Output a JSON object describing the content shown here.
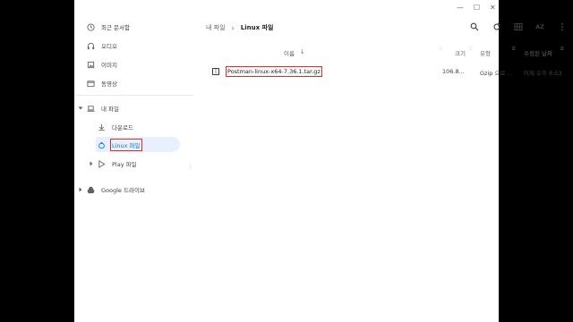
{
  "sidebar": {
    "recent": "최근 문서함",
    "audio": "오디오",
    "images": "이미지",
    "videos": "동영상",
    "my_files": "내 파일",
    "downloads": "다운로드",
    "linux_files": "Linux 파일",
    "play_files": "Play 파일",
    "google_drive": "Google 드라이브"
  },
  "breadcrumb": {
    "root": "내 파일",
    "current": "Linux 파일"
  },
  "toolbar": {
    "sort_label": "AZ"
  },
  "columns": {
    "name": "이름",
    "size": "크기",
    "type": "유형",
    "modified": "수정된 날짜"
  },
  "files": [
    {
      "name": "Postman-linux-x64-7.36.1.tar.gz",
      "size": "106.8...",
      "type": "Gzip 으로 ...",
      "modified": "어제 오후 8:53"
    }
  ],
  "colors": {
    "accent": "#1a73e8",
    "selected_bg": "#e8f0fe",
    "highlight_outline": "#d93025"
  }
}
